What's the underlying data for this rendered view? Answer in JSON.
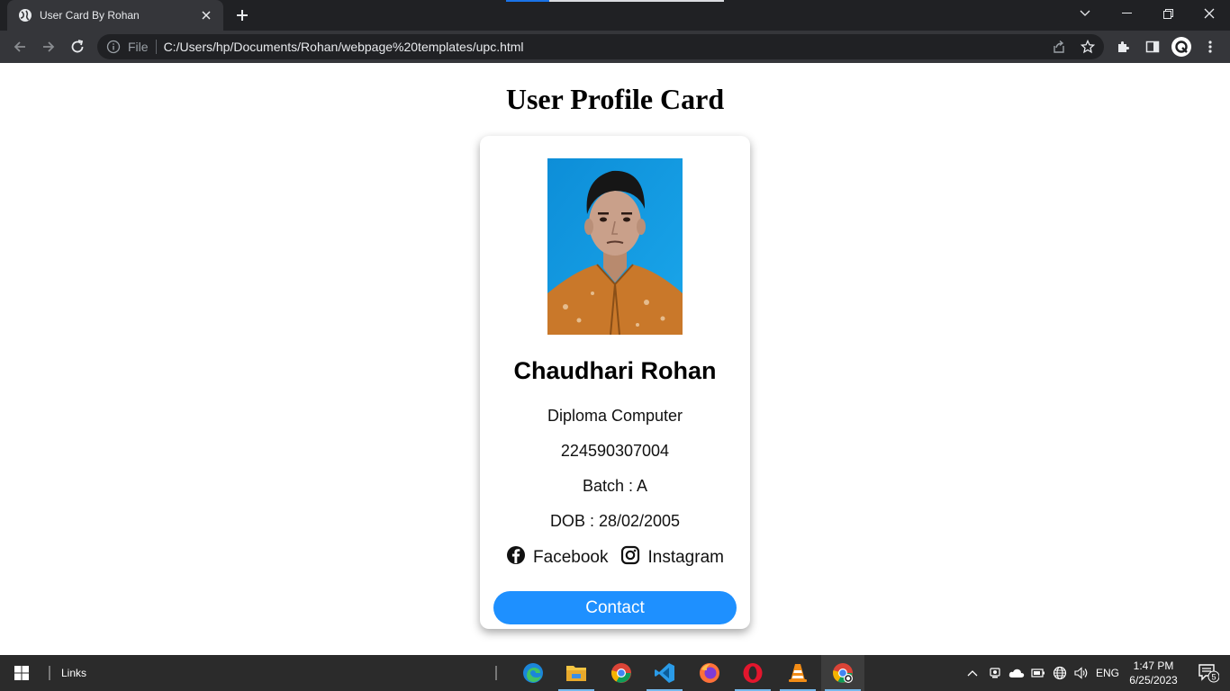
{
  "browser": {
    "tab_title": "User Card By Rohan",
    "file_label": "File",
    "url": "C:/Users/hp/Documents/Rohan/webpage%20templates/upc.html"
  },
  "page": {
    "title": "User Profile Card",
    "card": {
      "name": "Chaudhari Rohan",
      "course": "Diploma Computer",
      "enrollment": "224590307004",
      "batch": "Batch : A",
      "dob": "DOB : 28/02/2005",
      "facebook_label": "Facebook",
      "instagram_label": "Instagram",
      "contact_label": "Contact"
    }
  },
  "taskbar": {
    "links_label": "Links",
    "language": "ENG",
    "time": "1:47 PM",
    "date": "6/25/2023",
    "notification_count": "5",
    "apps": [
      "edge",
      "file-explorer",
      "chrome",
      "vscode",
      "firefox",
      "opera",
      "vlc",
      "chrome-active"
    ]
  },
  "colors": {
    "accent": "#1e90ff",
    "chrome_dark": "#202124",
    "chrome_toolbar": "#35363a",
    "taskbar": "#2b2b2b"
  }
}
